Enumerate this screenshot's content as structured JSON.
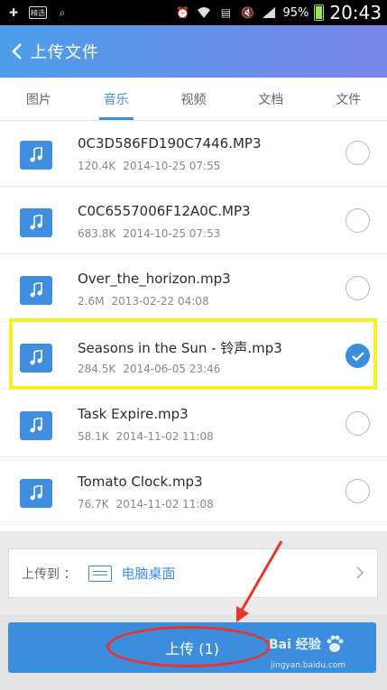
{
  "status_bar": {
    "notification_label": "精选",
    "battery_percent": "95%",
    "time": "20:43"
  },
  "header": {
    "title": "上传文件"
  },
  "tabs": [
    {
      "label": "图片",
      "active": false
    },
    {
      "label": "音乐",
      "active": true
    },
    {
      "label": "视频",
      "active": false
    },
    {
      "label": "文档",
      "active": false
    },
    {
      "label": "文件",
      "active": false
    }
  ],
  "files": [
    {
      "name": "0C3D586FD190C7446.MP3",
      "size": "120.4K",
      "date": "2014-10-25 07:55",
      "checked": false
    },
    {
      "name": "C0C6557006F12A0C.MP3",
      "size": "683.8K",
      "date": "2014-10-25 07:53",
      "checked": false
    },
    {
      "name": "Over_the_horizon.mp3",
      "size": "2.6M",
      "date": "2013-02-22 04:08",
      "checked": false
    },
    {
      "name": "Seasons in the Sun - 铃声.mp3",
      "size": "284.5K",
      "date": "2014-06-05 23:46",
      "checked": true
    },
    {
      "name": "Task Expire.mp3",
      "size": "58.1K",
      "date": "2014-11-02 11:08",
      "checked": false
    },
    {
      "name": "Tomato Clock.mp3",
      "size": "76.7K",
      "date": "2014-11-02 11:08",
      "checked": false
    }
  ],
  "destination": {
    "label": "上传到 ：",
    "value": "电脑桌面"
  },
  "upload": {
    "label": "上传 (1)"
  },
  "watermark": {
    "brand": "Bai 经验",
    "url": "jingyan.baidu.com"
  },
  "colors": {
    "accent": "#3d8ddf",
    "highlight": "#f7f21c",
    "annotation_red": "#e8352b"
  }
}
